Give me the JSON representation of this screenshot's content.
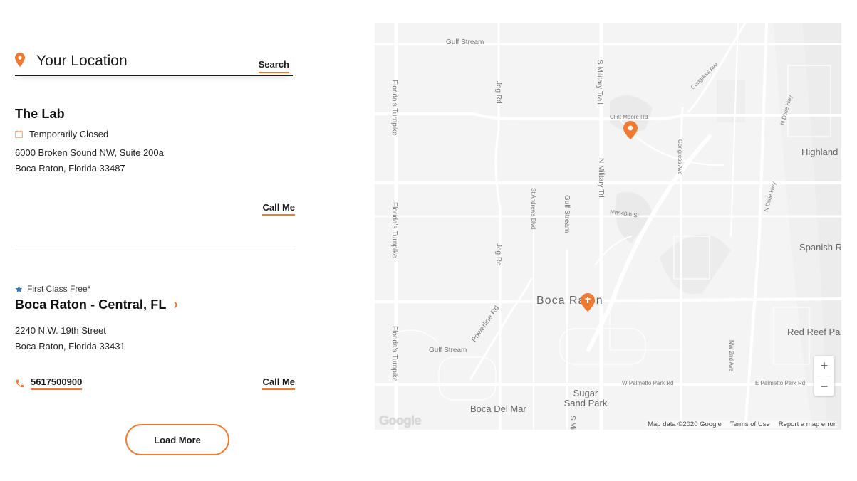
{
  "search": {
    "placeholder": "Your Location",
    "value": "",
    "button_label": "Search"
  },
  "locations": [
    {
      "name": "The Lab",
      "status": "Temporarily Closed",
      "status_icon": "calendar-icon",
      "address_line1": "6000 Broken Sound NW, Suite 200a",
      "address_line2": "Boca Raton, Florida 33487",
      "call_label": "Call Me"
    },
    {
      "promo": "First Class Free*",
      "promo_icon": "star-icon",
      "name": "Boca Raton - Central, FL",
      "address_line1": "2240 N.W. 19th Street",
      "address_line2": "Boca Raton, Florida 33431",
      "phone": "5617500900",
      "call_label": "Call Me"
    }
  ],
  "load_more_label": "Load More",
  "map": {
    "labels": {
      "gulf_stream_top": "Gulf Stream",
      "floridas_turnpike": "Florida's Turnpike",
      "jog_rd": "Jog Rd",
      "s_military_trail": "S Military Trail",
      "congress_ave": "Congress Ave",
      "clint_moore_rd": "Clint Moore Rd",
      "n_dixie_hwy": "N Dixie Hwy",
      "highland_beach": "Highland Beach",
      "n_military_trl": "N Military Trl",
      "st_andrews_blvd": "St Andrews Blvd",
      "gulf_stream_mid": "Gulf Stream",
      "nw_40th_st": "NW 40th St",
      "spanish_river_park": "Spanish River Park",
      "boca_raton": "Boca Raton",
      "powerline_rd": "Powerline Rd",
      "gulf_stream_bottom": "Gulf Stream",
      "red_reef_park": "Red Reef Park",
      "nw_2nd_ave": "NW 2nd Ave",
      "w_palmetto_park_rd": "W Palmetto Park Rd",
      "e_palmetto_park_rd": "E Palmetto Park Rd",
      "sugar_sand_park": "Sugar Sand Park",
      "boca_del_mar": "Boca Del Mar",
      "s_military": "S Mi"
    },
    "zoom_in": "+",
    "zoom_out": "−",
    "logo": "Google",
    "attribution": "Map data ©2020 Google",
    "terms": "Terms of Use",
    "report": "Report a map error"
  },
  "colors": {
    "accent": "#f07a30",
    "star": "#3a78b5",
    "map_bg": "#f4f4f4",
    "road": "#ffffff"
  }
}
